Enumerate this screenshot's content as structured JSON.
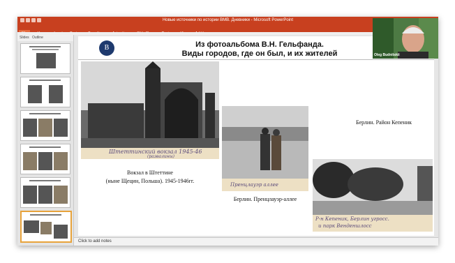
{
  "window": {
    "title": "Новые источники по истории ВМВ. Дневники - Microsoft PowerPoint"
  },
  "menu": {
    "items": [
      "File",
      "Home",
      "Insert",
      "Design",
      "Transitions",
      "Animations",
      "Slide Show",
      "Review",
      "View",
      "Add-Ins"
    ]
  },
  "pane_tabs": [
    "Slides",
    "Outline"
  ],
  "slide": {
    "logo_text": "B",
    "title_line1": "Из фотоальбома В.Н. Гельфанда.",
    "title_line2": "Виды городов, где он был, и их жителей",
    "caption_station": "Вокзал в Штеттине",
    "caption_station_sub": "(ныне Щецин, Польша). 1945-1946гг.",
    "caption_berlin_district": "Берлин. Район Кепеник",
    "caption_prenzlauer": "Берлин. Пренцлауэр-аллее",
    "hand_station": "Штеттинский вокзал 1945-46",
    "hand_station_sub": "(развалины)",
    "hand_prenz": "Пренцлауэр аллее",
    "hand_kopenick_1": "Р-н Кепеник, Берлин угросс.",
    "hand_kopenick_2": "и парк Венденшлосс"
  },
  "notes_placeholder": "Click to add notes",
  "video": {
    "participant_name": "Oleg Budnitskii"
  },
  "colors": {
    "accent": "#c8401f",
    "selected_thumb": "#e8a33b"
  }
}
